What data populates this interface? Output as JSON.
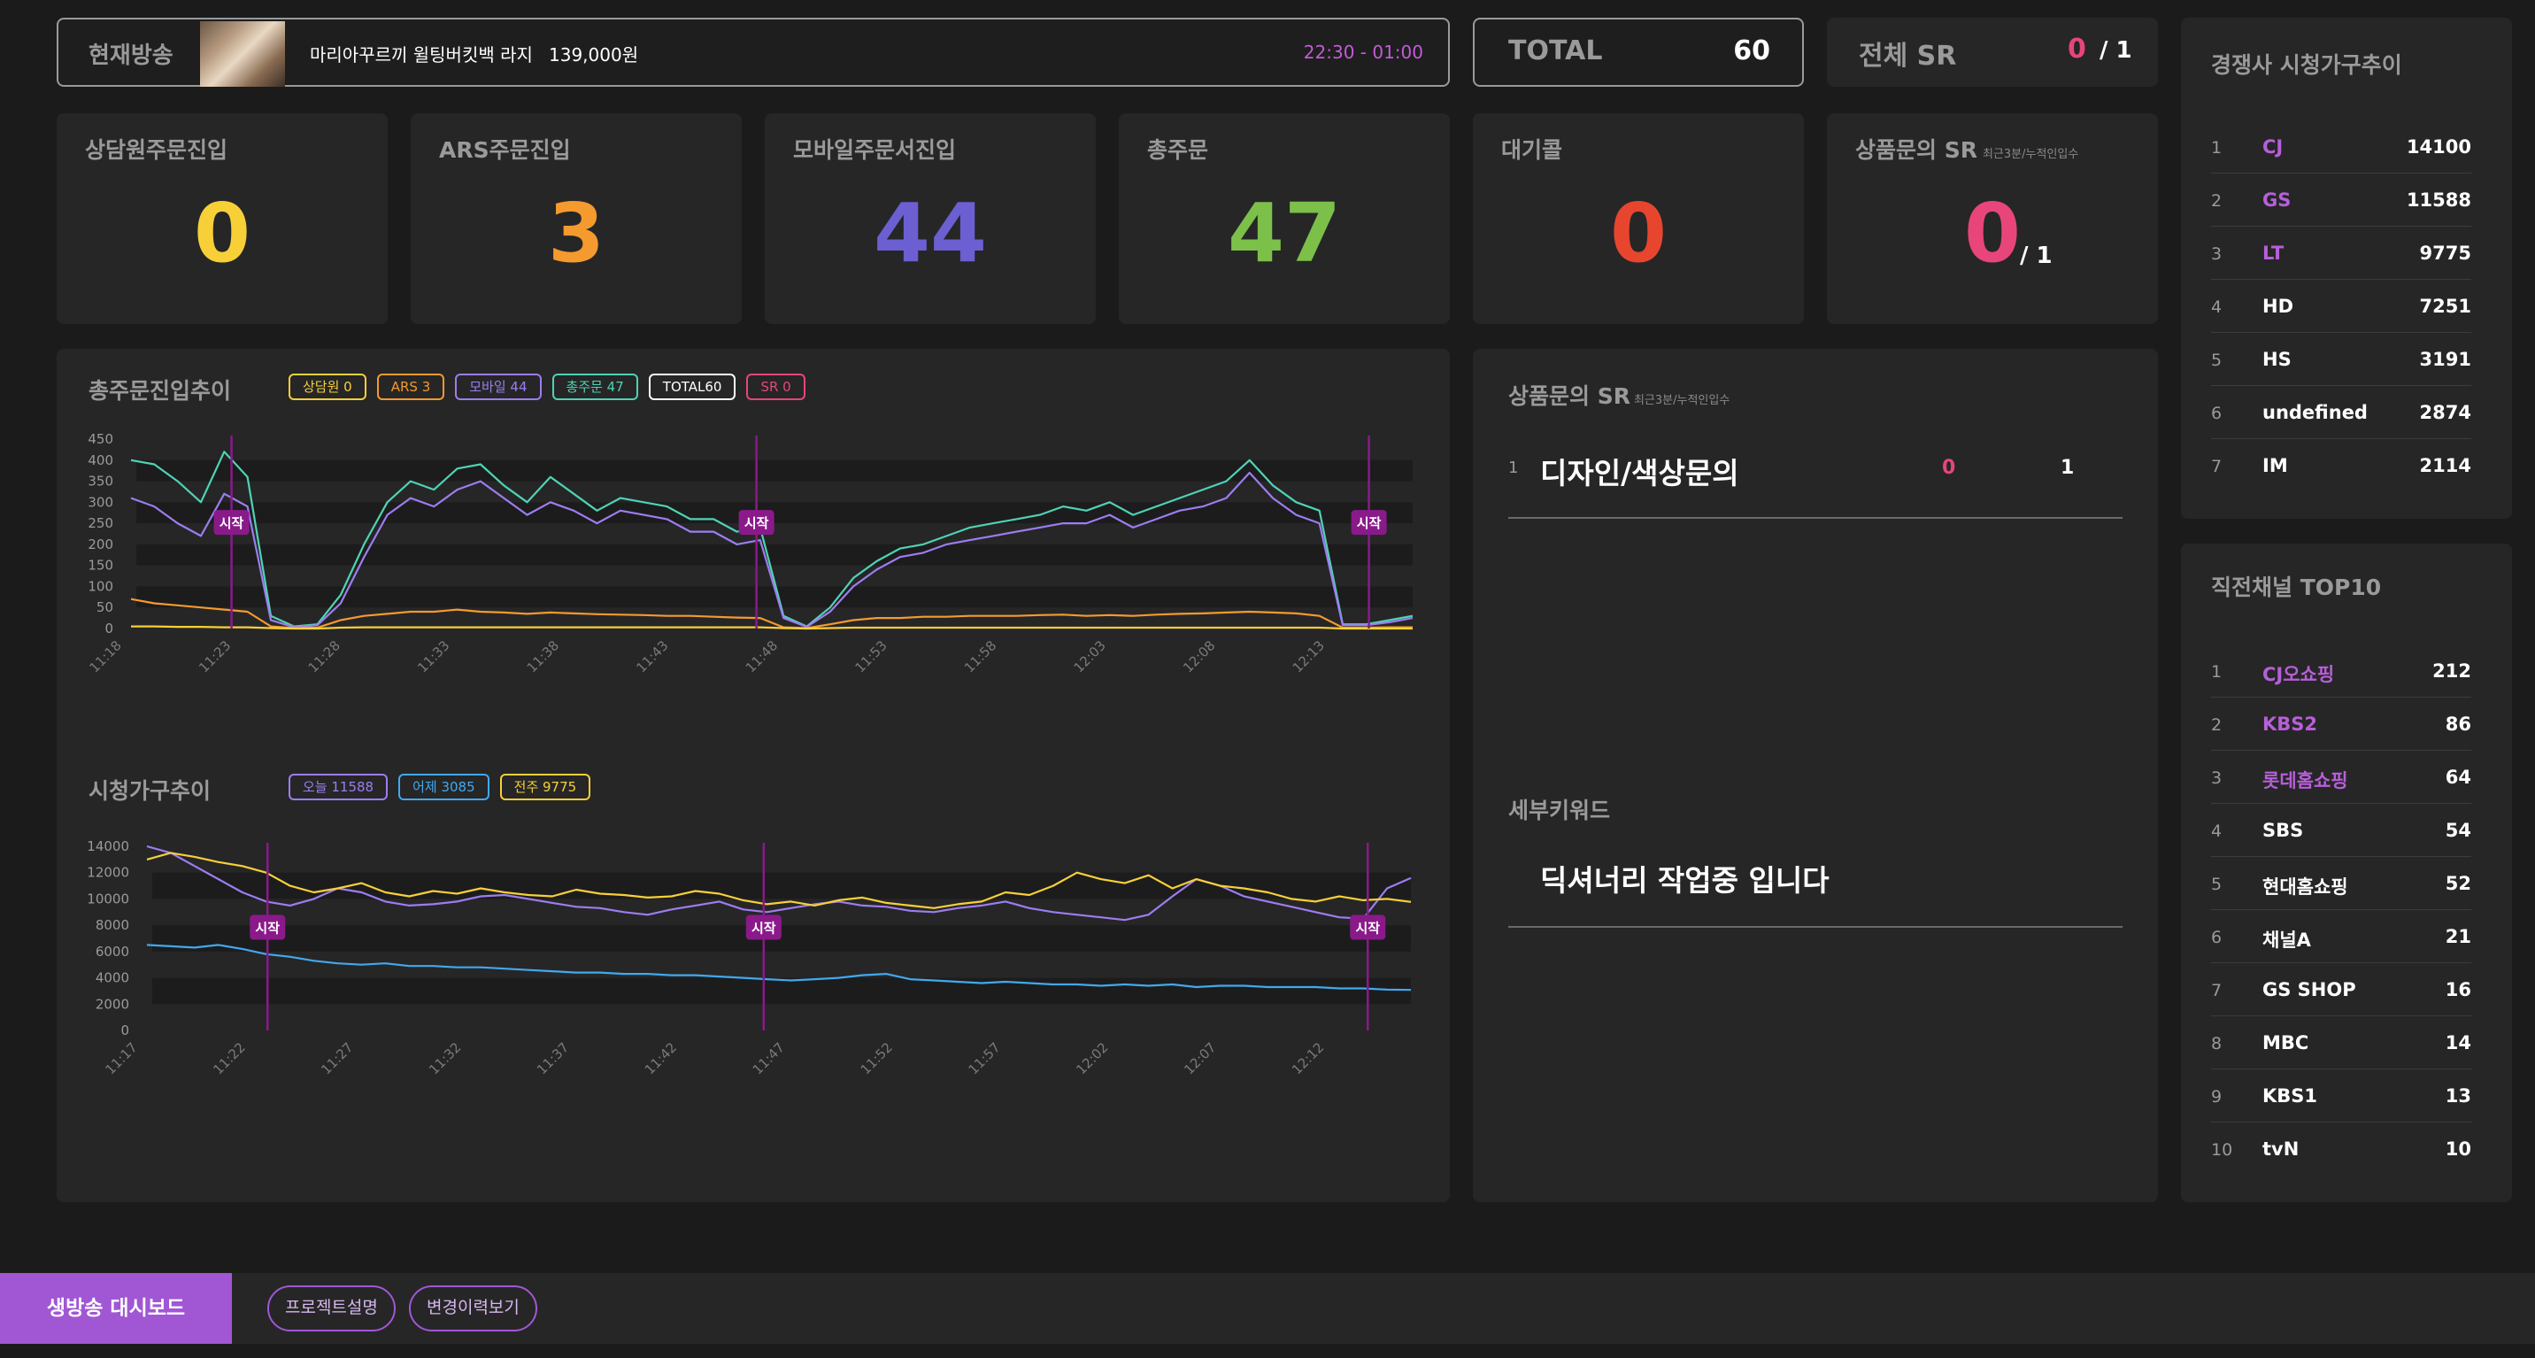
{
  "onair": {
    "label": "현재방송",
    "product": "마리아꾸르끼 윌팅버킷백 라지",
    "price": "139,000원",
    "time": "22:30 - 01:00"
  },
  "total": {
    "label": "TOTAL",
    "value": "60"
  },
  "total_sr": {
    "label": "전체 SR",
    "value": "0",
    "denom": "/ 1"
  },
  "cards": [
    {
      "title": "상담원주문진입",
      "value": "0",
      "color": "#f7d038"
    },
    {
      "title": "ARS주문진입",
      "value": "3",
      "color": "#f59a2e"
    },
    {
      "title": "모바일주문서진입",
      "value": "44",
      "color": "#6b5fd1"
    },
    {
      "title": "총주문",
      "value": "47",
      "color": "#7cc04a"
    },
    {
      "title": "대기콜",
      "value": "0",
      "color": "#e8452f"
    }
  ],
  "sr_card": {
    "title": "상품문의 SR",
    "note": "최근3분/누적인입수",
    "value": "0",
    "denom": "/ 1",
    "color": "#e8457a"
  },
  "order_trend": {
    "title": "총주문진입추이",
    "legend": [
      {
        "label": "상담원 0",
        "color": "#f7d038"
      },
      {
        "label": "ARS 3",
        "color": "#f59a2e"
      },
      {
        "label": "모바일 44",
        "color": "#9d7df0"
      },
      {
        "label": "총주문 47",
        "color": "#4fd3b4"
      },
      {
        "label": "TOTAL60",
        "color": "#ffffff"
      },
      {
        "label": "SR 0",
        "color": "#e8457a"
      }
    ],
    "marker_label": "시작"
  },
  "viewer_trend": {
    "title": "시청가구추이",
    "legend": [
      {
        "label": "오늘 11588",
        "color": "#9d7df0"
      },
      {
        "label": "어제 3085",
        "color": "#41a9ee"
      },
      {
        "label": "전주 9775",
        "color": "#f7d038"
      }
    ],
    "marker_label": "시작"
  },
  "chart_data": [
    {
      "type": "line",
      "title": "총주문진입추이",
      "ylim": [
        0,
        450
      ],
      "yticks": [
        0,
        50,
        100,
        150,
        200,
        250,
        300,
        350,
        400,
        450
      ],
      "xticks": [
        "11:18",
        "11:23",
        "11:28",
        "11:33",
        "11:38",
        "11:43",
        "11:48",
        "11:53",
        "11:58",
        "12:03",
        "12:08",
        "12:13"
      ],
      "markers": [
        "11:23",
        "11:47",
        "12:15"
      ],
      "series": [
        {
          "name": "총주문",
          "color": "#4fd3b4",
          "values": [
            400,
            390,
            350,
            300,
            420,
            360,
            30,
            5,
            10,
            80,
            200,
            300,
            350,
            330,
            380,
            390,
            340,
            300,
            360,
            320,
            280,
            310,
            300,
            290,
            260,
            260,
            230,
            240,
            30,
            5,
            50,
            120,
            160,
            190,
            200,
            220,
            240,
            250,
            260,
            270,
            290,
            280,
            300,
            270,
            290,
            310,
            330,
            350,
            400,
            340,
            300,
            280,
            10,
            10,
            20,
            30
          ]
        },
        {
          "name": "모바일",
          "color": "#9d7df0",
          "values": [
            310,
            290,
            250,
            220,
            320,
            290,
            20,
            3,
            8,
            60,
            170,
            270,
            310,
            290,
            330,
            350,
            310,
            270,
            300,
            280,
            250,
            280,
            270,
            260,
            230,
            230,
            200,
            210,
            25,
            4,
            40,
            100,
            140,
            170,
            180,
            200,
            210,
            220,
            230,
            240,
            250,
            250,
            270,
            240,
            260,
            280,
            290,
            310,
            370,
            310,
            270,
            250,
            8,
            8,
            15,
            25
          ]
        },
        {
          "name": "ARS",
          "color": "#f59a2e",
          "values": [
            70,
            60,
            55,
            50,
            45,
            40,
            5,
            1,
            2,
            20,
            30,
            35,
            40,
            40,
            45,
            40,
            38,
            35,
            38,
            36,
            34,
            33,
            32,
            30,
            30,
            28,
            26,
            25,
            3,
            1,
            10,
            20,
            25,
            25,
            28,
            28,
            30,
            30,
            30,
            32,
            33,
            30,
            32,
            30,
            33,
            35,
            36,
            38,
            40,
            38,
            36,
            30,
            2,
            2,
            3,
            3
          ]
        },
        {
          "name": "상담원",
          "color": "#f7d038",
          "values": [
            5,
            5,
            4,
            4,
            3,
            3,
            1,
            0,
            0,
            2,
            3,
            3,
            3,
            3,
            3,
            3,
            3,
            3,
            3,
            3,
            3,
            3,
            3,
            3,
            3,
            3,
            3,
            3,
            1,
            0,
            1,
            2,
            2,
            2,
            2,
            2,
            2,
            2,
            2,
            2,
            2,
            2,
            2,
            2,
            2,
            2,
            2,
            2,
            2,
            2,
            2,
            2,
            0,
            0,
            0,
            0
          ]
        }
      ]
    },
    {
      "type": "line",
      "title": "시청가구추이",
      "ylim": [
        0,
        14000
      ],
      "yticks": [
        0,
        2000,
        4000,
        6000,
        8000,
        10000,
        12000,
        14000
      ],
      "xticks": [
        "11:17",
        "11:22",
        "11:27",
        "11:32",
        "11:37",
        "11:42",
        "11:47",
        "11:52",
        "11:57",
        "12:02",
        "12:07",
        "12:12"
      ],
      "markers": [
        "11:23",
        "11:46",
        "12:14"
      ],
      "series": [
        {
          "name": "오늘",
          "color": "#9d7df0",
          "values": [
            14000,
            13500,
            12500,
            11500,
            10500,
            9800,
            9500,
            10000,
            10800,
            10500,
            9800,
            9500,
            9600,
            9800,
            10200,
            10300,
            10000,
            9700,
            9400,
            9300,
            9000,
            8800,
            9200,
            9500,
            9800,
            9200,
            9000,
            9300,
            9600,
            9800,
            9500,
            9400,
            9100,
            9000,
            9300,
            9500,
            9800,
            9300,
            9000,
            8800,
            8600,
            8400,
            8800,
            10200,
            11500,
            11000,
            10200,
            9800,
            9400,
            9000,
            8600,
            8500,
            10800,
            11600
          ]
        },
        {
          "name": "전주",
          "color": "#f7d038",
          "values": [
            13000,
            13500,
            13200,
            12800,
            12500,
            12000,
            11000,
            10500,
            10800,
            11200,
            10500,
            10200,
            10600,
            10400,
            10800,
            10500,
            10300,
            10200,
            10700,
            10400,
            10300,
            10100,
            10200,
            10600,
            10400,
            9900,
            9600,
            9800,
            9500,
            9900,
            10100,
            9700,
            9500,
            9300,
            9600,
            9800,
            10500,
            10300,
            11000,
            12000,
            11500,
            11200,
            11800,
            10800,
            11500,
            11000,
            10800,
            10500,
            10000,
            9800,
            10200,
            9900,
            10000,
            9775
          ]
        },
        {
          "name": "어제",
          "color": "#41a9ee",
          "values": [
            6500,
            6400,
            6300,
            6500,
            6200,
            5800,
            5600,
            5300,
            5100,
            5000,
            5100,
            4900,
            4900,
            4800,
            4800,
            4700,
            4600,
            4500,
            4400,
            4400,
            4300,
            4300,
            4200,
            4200,
            4100,
            4000,
            3900,
            3800,
            3900,
            4000,
            4200,
            4300,
            3900,
            3800,
            3700,
            3600,
            3700,
            3600,
            3500,
            3500,
            3400,
            3500,
            3400,
            3500,
            3300,
            3400,
            3400,
            3300,
            3300,
            3300,
            3200,
            3200,
            3100,
            3085
          ]
        }
      ]
    }
  ],
  "product_sr": {
    "title": "상품문의 SR",
    "note": "최근3분/누적인입수",
    "rows": [
      {
        "num": "1",
        "name": "디자인/색상문의",
        "recent": "0",
        "total": "1"
      }
    ]
  },
  "keyword": {
    "title": "세부키워드",
    "text": "딕셔너리 작업중 입니다"
  },
  "competitor": {
    "title": "경쟁사 시청가구추이",
    "rows": [
      {
        "num": "1",
        "name": "CJ",
        "value": "14100",
        "highlight": true
      },
      {
        "num": "2",
        "name": "GS",
        "value": "11588",
        "highlight": true
      },
      {
        "num": "3",
        "name": "LT",
        "value": "9775",
        "highlight": true
      },
      {
        "num": "4",
        "name": "HD",
        "value": "7251",
        "highlight": false
      },
      {
        "num": "5",
        "name": "HS",
        "value": "3191",
        "highlight": false
      },
      {
        "num": "6",
        "name": "undefined",
        "value": "2874",
        "highlight": false
      },
      {
        "num": "7",
        "name": "IM",
        "value": "2114",
        "highlight": false
      }
    ]
  },
  "direct_channels": {
    "title": "직전채널 TOP10",
    "rows": [
      {
        "num": "1",
        "name": "CJ오쇼핑",
        "value": "212",
        "highlight": true
      },
      {
        "num": "2",
        "name": "KBS2",
        "value": "86",
        "highlight": true
      },
      {
        "num": "3",
        "name": "롯데홈쇼핑",
        "value": "64",
        "highlight": true
      },
      {
        "num": "4",
        "name": "SBS",
        "value": "54",
        "highlight": false
      },
      {
        "num": "5",
        "name": "현대홈쇼핑",
        "value": "52",
        "highlight": false
      },
      {
        "num": "6",
        "name": "채널A",
        "value": "21",
        "highlight": false
      },
      {
        "num": "7",
        "name": "GS SHOP",
        "value": "16",
        "highlight": false
      },
      {
        "num": "8",
        "name": "MBC",
        "value": "14",
        "highlight": false
      },
      {
        "num": "9",
        "name": "KBS1",
        "value": "13",
        "highlight": false
      },
      {
        "num": "10",
        "name": "tvN",
        "value": "10",
        "highlight": false
      }
    ]
  },
  "footer": {
    "brand": "생방송 대시보드",
    "buttons": [
      "프로젝트설명",
      "변경이력보기"
    ]
  },
  "colors": {
    "accent": "#a157d4",
    "highlight_text": "#b75fd8",
    "marker": "#8a1a8a"
  }
}
